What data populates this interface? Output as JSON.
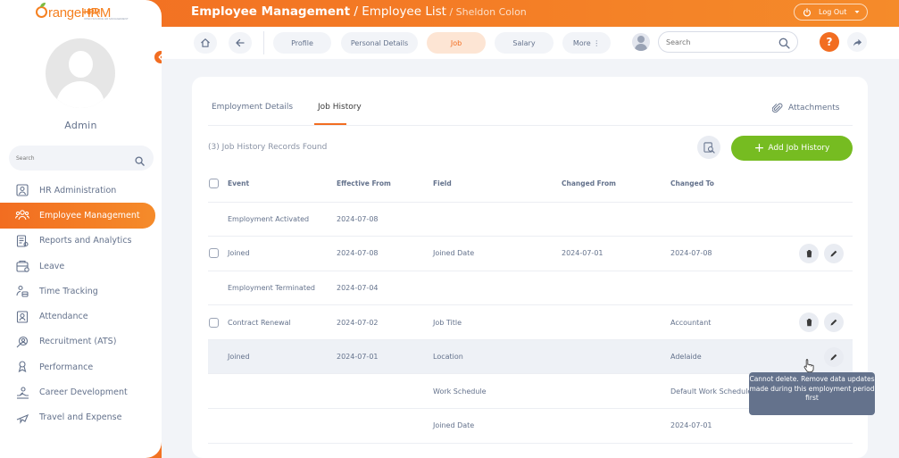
{
  "sidebar": {
    "logo_text": "rangeHRM",
    "logo_hrm": "HRM",
    "logo_sub": "OPEN SOURCE HR MANAGEMENT",
    "user_name": "Admin",
    "search_placeholder": "Search",
    "items": [
      {
        "label": "HR Administration",
        "icon": "admin-icon"
      },
      {
        "label": "Employee Management",
        "icon": "employees-icon",
        "active": true
      },
      {
        "label": "Reports and Analytics",
        "icon": "reports-icon"
      },
      {
        "label": "Leave",
        "icon": "leave-icon"
      },
      {
        "label": "Time Tracking",
        "icon": "time-icon"
      },
      {
        "label": "Attendance",
        "icon": "attendance-icon"
      },
      {
        "label": "Recruitment (ATS)",
        "icon": "recruitment-icon"
      },
      {
        "label": "Performance",
        "icon": "performance-icon"
      },
      {
        "label": "Career Development",
        "icon": "career-icon"
      },
      {
        "label": "Travel and Expense",
        "icon": "travel-icon"
      }
    ]
  },
  "header": {
    "title": "Employee Management",
    "sep": " / ",
    "crumb": "Employee List",
    "crumb2": " / Sheldon Colon",
    "logout_label": "Log Out"
  },
  "nav": {
    "tabs": [
      {
        "label": "Profile",
        "active": false
      },
      {
        "label": "Personal Details",
        "active": false
      },
      {
        "label": "Job",
        "active": true
      },
      {
        "label": "Salary",
        "active": false
      },
      {
        "label": "More ⋮",
        "active": false
      }
    ],
    "search_placeholder": "Search",
    "help_label": "?"
  },
  "card": {
    "tabs": [
      "Employment Details",
      "Job History"
    ],
    "active_tab": "Job History",
    "attachments_label": "Attachments",
    "records_found": "(3) Job History Records Found",
    "add_label": "Add Job History",
    "columns": [
      "Event",
      "Effective From",
      "Field",
      "Changed From",
      "Changed To"
    ],
    "rows": [
      {
        "checkbox": false,
        "event": "Employment Activated",
        "effective": "2024-07-08",
        "field": "",
        "from": "",
        "to": "",
        "actions": false
      },
      {
        "checkbox": true,
        "event": "Joined",
        "effective": "2024-07-08",
        "field": "Joined Date",
        "from": "2024-07-01",
        "to": "2024-07-08",
        "actions": true
      },
      {
        "checkbox": false,
        "event": "Employment Terminated",
        "effective": "2024-07-04",
        "field": "",
        "from": "",
        "to": "",
        "actions": false
      },
      {
        "checkbox": true,
        "event": "Contract Renewal",
        "effective": "2024-07-02",
        "field": "Job Title",
        "from": "",
        "to": "Accountant",
        "actions": true
      },
      {
        "checkbox": false,
        "event": "Joined",
        "effective": "2024-07-01",
        "field": "Location",
        "from": "",
        "to": "Adelaide",
        "actions": true,
        "hover": true
      },
      {
        "checkbox": false,
        "event": "",
        "effective": "",
        "field": "Work Schedule",
        "from": "",
        "to": "Default Work Schedule",
        "actions": false
      },
      {
        "checkbox": false,
        "event": "",
        "effective": "",
        "field": "Joined Date",
        "from": "",
        "to": "2024-07-01",
        "actions": false
      }
    ]
  },
  "tooltip": "Cannot delete. Remove data updates made during this employment period first",
  "colors": {
    "accent": "#f26d21",
    "green": "#76bc21",
    "text": "#64728c",
    "tooltip_bg": "#64728c"
  }
}
